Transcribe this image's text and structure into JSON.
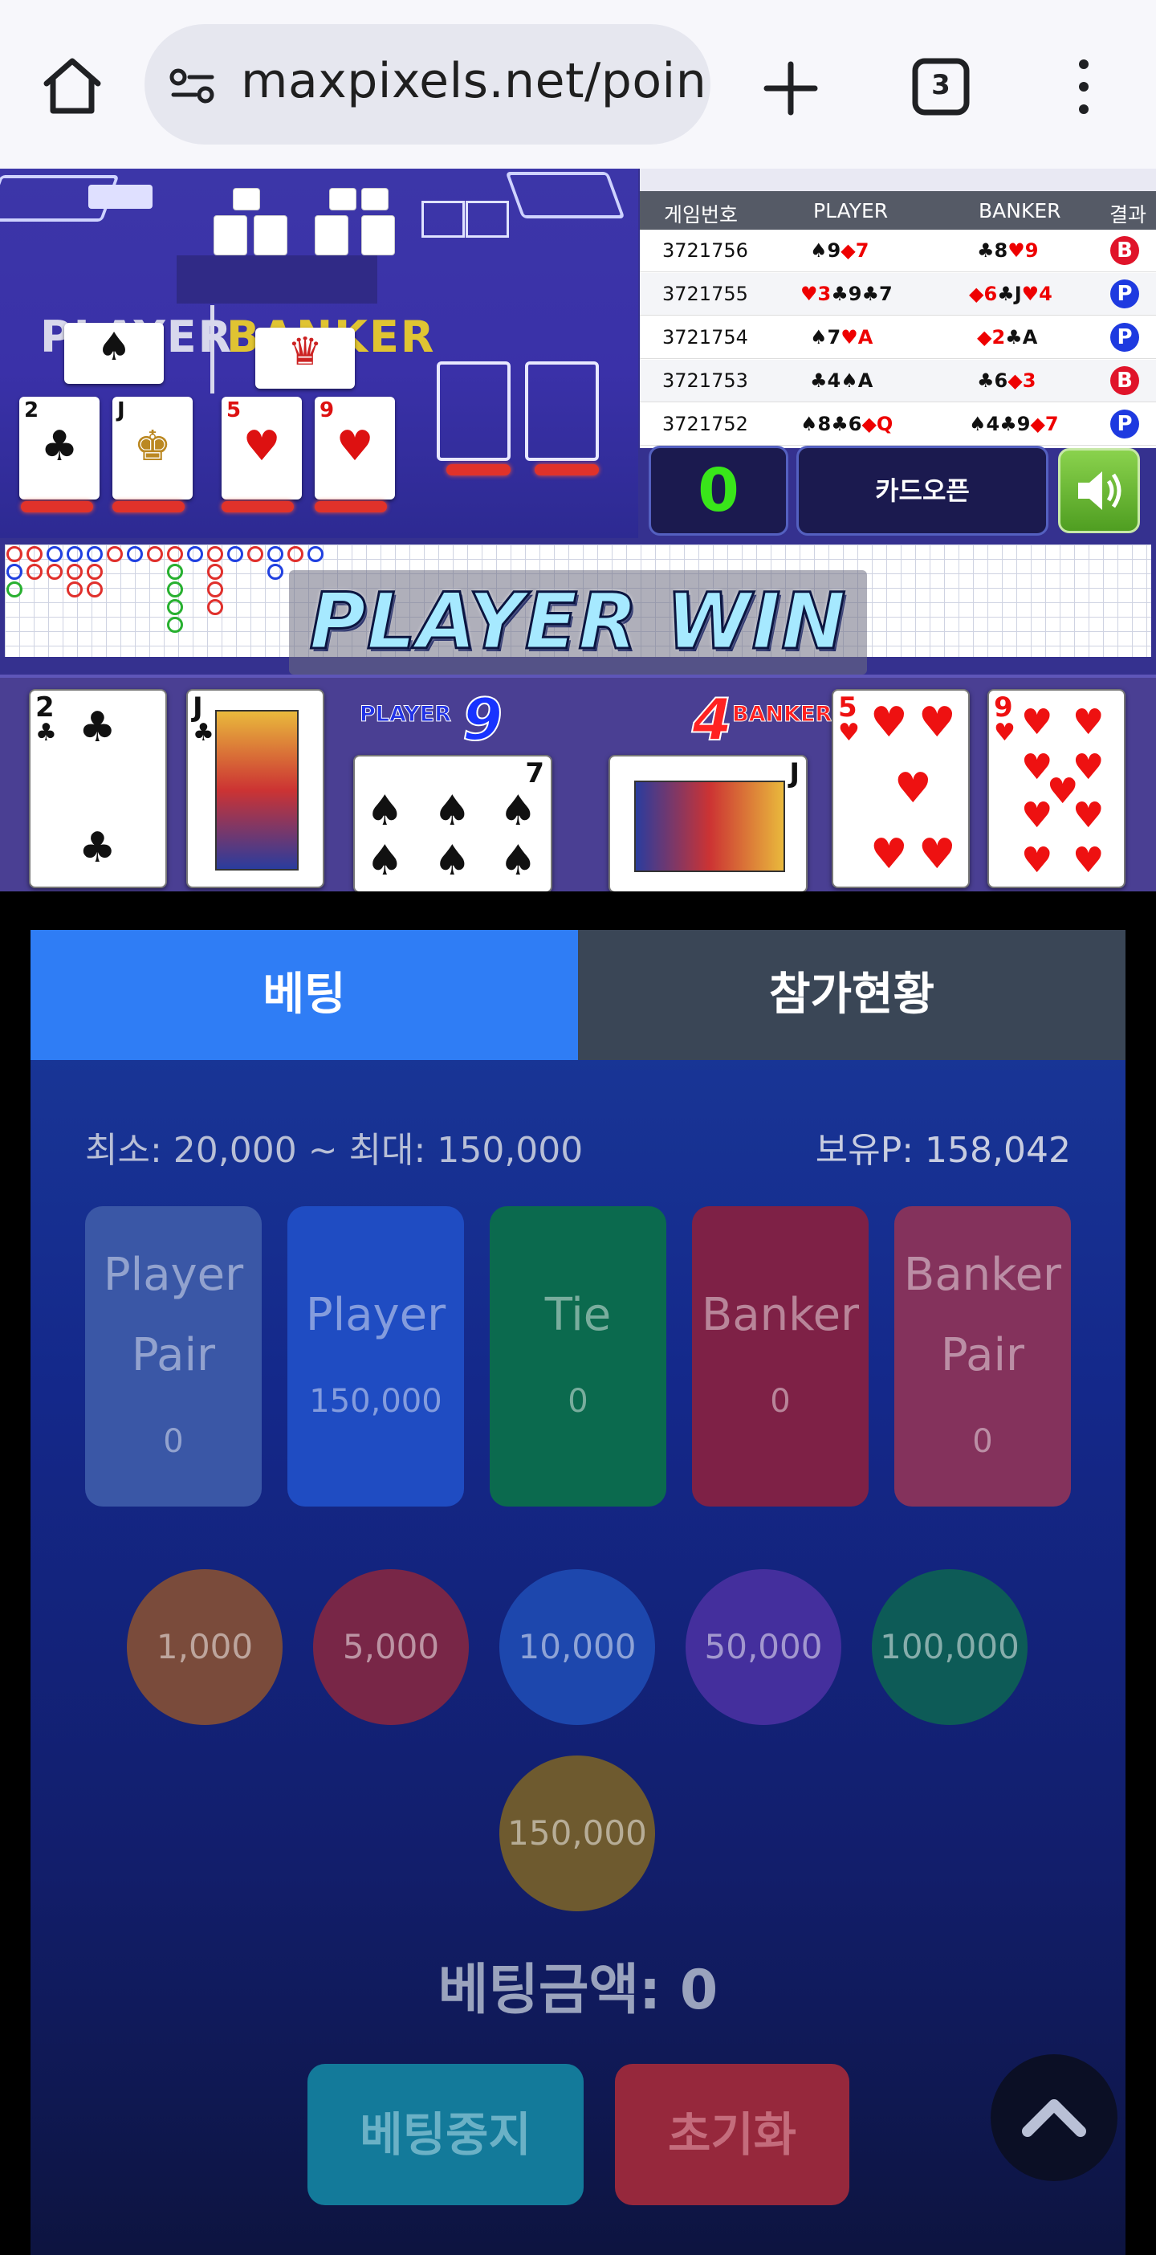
{
  "browser": {
    "url": "maxpixels.net/poin",
    "tab_count": "3"
  },
  "history": {
    "headers": [
      "게임번호",
      "PLAYER",
      "BANKER",
      "결과"
    ],
    "rows": [
      {
        "game": "3721756",
        "player": [
          {
            "suit": "♠",
            "rank": "9",
            "c": "#111"
          },
          {
            "suit": "◆",
            "rank": "7",
            "c": "#e00"
          }
        ],
        "banker": [
          {
            "suit": "♣",
            "rank": "8",
            "c": "#111"
          },
          {
            "suit": "♥",
            "rank": "9",
            "c": "#e00"
          }
        ],
        "result": "B"
      },
      {
        "game": "3721755",
        "player": [
          {
            "suit": "♥",
            "rank": "3",
            "c": "#e00"
          },
          {
            "suit": "♣",
            "rank": "9",
            "c": "#111"
          },
          {
            "suit": "♣",
            "rank": "7",
            "c": "#111"
          }
        ],
        "banker": [
          {
            "suit": "◆",
            "rank": "6",
            "c": "#e00"
          },
          {
            "suit": "♣",
            "rank": "J",
            "c": "#111"
          },
          {
            "suit": "♥",
            "rank": "4",
            "c": "#e00"
          }
        ],
        "result": "P"
      },
      {
        "game": "3721754",
        "player": [
          {
            "suit": "♠",
            "rank": "7",
            "c": "#111"
          },
          {
            "suit": "♥",
            "rank": "A",
            "c": "#e00"
          }
        ],
        "banker": [
          {
            "suit": "◆",
            "rank": "2",
            "c": "#e00"
          },
          {
            "suit": "♣",
            "rank": "A",
            "c": "#111"
          }
        ],
        "result": "P"
      },
      {
        "game": "3721753",
        "player": [
          {
            "suit": "♣",
            "rank": "4",
            "c": "#111"
          },
          {
            "suit": "♠",
            "rank": "A",
            "c": "#111"
          }
        ],
        "banker": [
          {
            "suit": "♣",
            "rank": "6",
            "c": "#111"
          },
          {
            "suit": "◆",
            "rank": "3",
            "c": "#e00"
          }
        ],
        "result": "B"
      },
      {
        "game": "3721752",
        "player": [
          {
            "suit": "♠",
            "rank": "8",
            "c": "#111"
          },
          {
            "suit": "♣",
            "rank": "6",
            "c": "#111"
          },
          {
            "suit": "◆",
            "rank": "Q",
            "c": "#e00"
          }
        ],
        "banker": [
          {
            "suit": "♠",
            "rank": "4",
            "c": "#111"
          },
          {
            "suit": "♣",
            "rank": "9",
            "c": "#111"
          },
          {
            "suit": "◆",
            "rank": "7",
            "c": "#e00"
          }
        ],
        "result": "P"
      }
    ]
  },
  "controls": {
    "counter": "0",
    "card_open": "카드오픈"
  },
  "table": {
    "player_label": "PLAYER",
    "banker_label": "BANKER"
  },
  "banner": "PLAYER WIN",
  "result": {
    "player_label": "PLAYER",
    "player_score": "9",
    "banker_label": "BANKER",
    "banker_score": "4",
    "player_cards": [
      {
        "rank": "2",
        "suit": "♣",
        "color": "#111"
      },
      {
        "rank": "J",
        "suit": "♣",
        "color": "#111"
      },
      {
        "rank": "7",
        "suit": "♠",
        "color": "#111"
      }
    ],
    "banker_cards": [
      {
        "rank": "J",
        "suit": "♠",
        "color": "#111"
      },
      {
        "rank": "5",
        "suit": "♥",
        "color": "#e11"
      },
      {
        "rank": "9",
        "suit": "♥",
        "color": "#e11"
      }
    ]
  },
  "betting": {
    "tabs": [
      "베팅",
      "참가현황"
    ],
    "limit": "최소: 20,000 ~ 최대: 150,000",
    "points": "보유P: 158,042",
    "options": [
      {
        "label1": "Player",
        "label2": "Pair",
        "amount": "0",
        "color": "#3a57a6"
      },
      {
        "label1": "Player",
        "label2": "",
        "amount": "150,000",
        "color": "#1f4cc2"
      },
      {
        "label1": "Tie",
        "label2": "",
        "amount": "0",
        "color": "#0b6a4e"
      },
      {
        "label1": "Banker",
        "label2": "",
        "amount": "0",
        "color": "#7e2146"
      },
      {
        "label1": "Banker",
        "label2": "Pair",
        "amount": "0",
        "color": "#84325c"
      }
    ],
    "chips": [
      {
        "label": "1,000",
        "color": "#7a4b3b"
      },
      {
        "label": "5,000",
        "color": "#782647"
      },
      {
        "label": "10,000",
        "color": "#1d47ad"
      },
      {
        "label": "50,000",
        "color": "#442f9d"
      },
      {
        "label": "100,000",
        "color": "#0d5b57"
      },
      {
        "label": "150,000",
        "color": "#6e5a2f"
      }
    ],
    "bet_amount": "베팅금액: 0",
    "stop_label": "베팅중지",
    "reset_label": "초기화"
  }
}
